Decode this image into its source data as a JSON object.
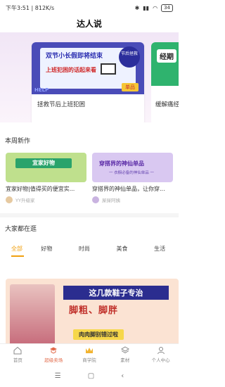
{
  "status_bar": {
    "time": "下午3:51",
    "speed": "812K/s",
    "battery": "34"
  },
  "app_title": "达人说",
  "carousel": [
    {
      "caption": "拯救节后上班犯困",
      "image_text_line1": "双节小长假即将结束",
      "image_text_line2": "上班犯困的话起来看",
      "badge_text": "节后拯救",
      "tag_text": "单品",
      "help_text": "HELP"
    },
    {
      "caption": "缓解痛经",
      "image_text": "经期"
    }
  ],
  "sections": {
    "new_works_title": "本周新作",
    "stroll_title": "大家都在逛"
  },
  "new_works": [
    {
      "title": "宜家好物|值得买的便宜实...",
      "author": "YY升级家",
      "thumb_text": "宜家好物"
    },
    {
      "title": "穿搭界的神仙单品，让你穿...",
      "author": "屎屎阿姨",
      "thumb_text": "穿搭界的神仙单品",
      "thumb_sub": "一 衣橱必备的神仙单品 一"
    }
  ],
  "tabs": [
    "全部",
    "好物",
    "时尚",
    "美食",
    "生活"
  ],
  "feature": {
    "line1": "这几款鞋子专治",
    "line2": "脚粗、脚胖",
    "line3": "肉肉脚别错过啦"
  },
  "bottom_nav": [
    {
      "label": "首页",
      "icon": "home-icon"
    },
    {
      "label": "超级卖场",
      "icon": "mortarboard-icon"
    },
    {
      "label": "商学院",
      "icon": "crown-icon"
    },
    {
      "label": "素材",
      "icon": "layers-icon"
    },
    {
      "label": "个人中心",
      "icon": "person-icon"
    }
  ],
  "colors": {
    "accent": "#f0a010",
    "nav_active": "#e26a4a"
  }
}
